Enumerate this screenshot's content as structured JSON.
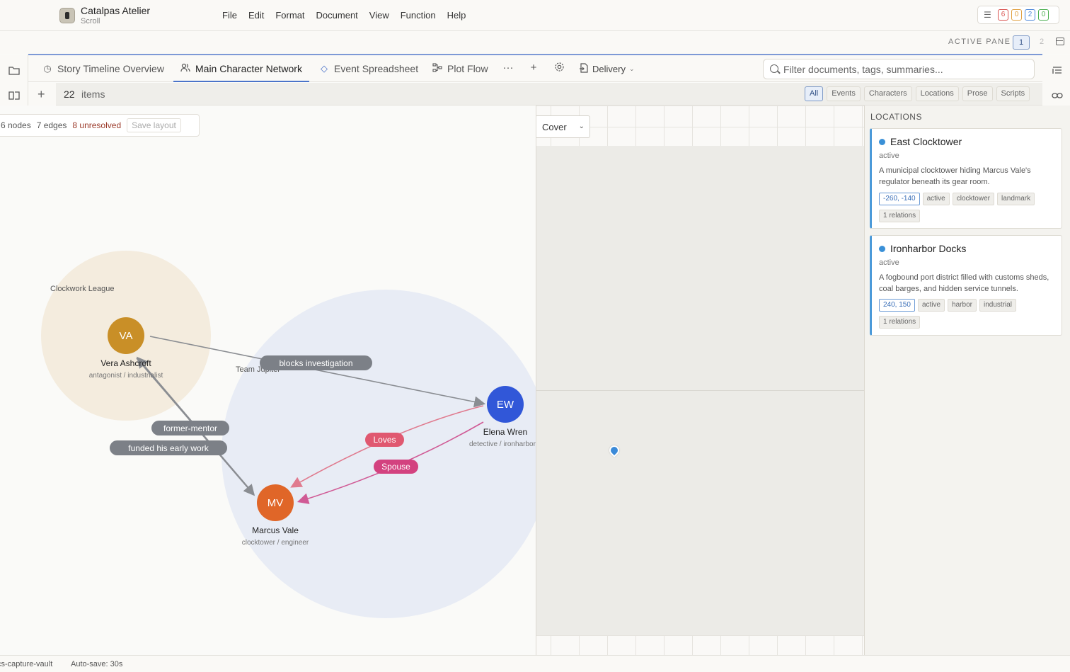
{
  "app": {
    "name": "Catalpas Atelier",
    "subtitle": "Scroll"
  },
  "menu": [
    "File",
    "Edit",
    "Format",
    "Document",
    "View",
    "Function",
    "Help"
  ],
  "status_counts": [
    {
      "value": "6",
      "color": "#d9534f"
    },
    {
      "value": "0",
      "color": "#e0a040"
    },
    {
      "value": "2",
      "color": "#4a86d8"
    },
    {
      "value": "0",
      "color": "#4caf50"
    }
  ],
  "active_pane": {
    "label": "ACTIVE PANE",
    "pane1": "1",
    "pane2": "2"
  },
  "tabs": [
    {
      "label": "Story Timeline Overview",
      "icon": "clock-icon"
    },
    {
      "label": "Main Character Network",
      "icon": "users-icon"
    },
    {
      "label": "Event Spreadsheet",
      "icon": "diamond-icon"
    },
    {
      "label": "Plot Flow",
      "icon": "flow-icon"
    }
  ],
  "toolbar": {
    "more": "···",
    "add": "+",
    "delivery": "Delivery"
  },
  "search": {
    "placeholder": "Filter documents, tags, summaries..."
  },
  "items": {
    "count": "22",
    "label": "items"
  },
  "filters": [
    "All",
    "Events",
    "Characters",
    "Locations",
    "Prose",
    "Scripts"
  ],
  "graph": {
    "stats": {
      "nodes": "6 nodes",
      "edges": "7 edges",
      "unresolved": "8 unresolved",
      "save": "Save layout"
    },
    "groups": [
      {
        "label": "Clockwork League",
        "color": "#f4ecde"
      },
      {
        "label": "Team Jupiter",
        "color": "#e8ecf5"
      }
    ],
    "nodes": [
      {
        "initials": "VA",
        "name": "Vera Ashcroft",
        "role": "antagonist / industrialist",
        "color": "#c98f27"
      },
      {
        "initials": "EW",
        "name": "Elena Wren",
        "role": "detective / ironharbor",
        "color": "#3157d8"
      },
      {
        "initials": "MV",
        "name": "Marcus Vale",
        "role": "clocktower / engineer",
        "color": "#e06628"
      }
    ],
    "edges": [
      {
        "label": "blocks investigation",
        "color": "#7c8087"
      },
      {
        "label": "former-mentor",
        "color": "#7c8087"
      },
      {
        "label": "funded his early work",
        "color": "#7c8087"
      },
      {
        "label": "Loves",
        "color": "#e05870"
      },
      {
        "label": "Spouse",
        "color": "#d3427f"
      }
    ]
  },
  "map": {
    "cover": "Cover"
  },
  "locations": {
    "title": "LOCATIONS",
    "cards": [
      {
        "name": "East Clocktower",
        "status": "active",
        "description": "A municipal clocktower hiding Marcus Vale's regulator beneath its gear room.",
        "coords": "-260, -140",
        "tags": [
          "active",
          "clocktower",
          "landmark"
        ],
        "relations": "1 relations"
      },
      {
        "name": "Ironharbor Docks",
        "status": "active",
        "description": "A fogbound port district filled with customs sheds, coal barges, and hidden service tunnels.",
        "coords": "240, 150",
        "tags": [
          "active",
          "harbor",
          "industrial"
        ],
        "relations": "1 relations"
      }
    ]
  },
  "footer": {
    "vault": "cs-capture-vault",
    "autosave": "Auto-save: 30s"
  }
}
